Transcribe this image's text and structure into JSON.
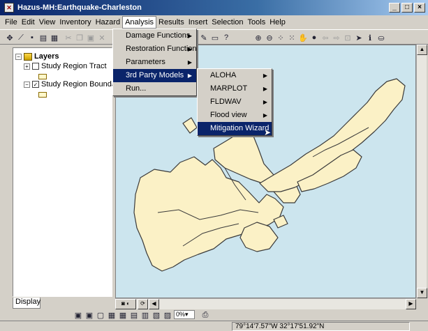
{
  "window": {
    "title": "Hazus-MH:Earthquake-Charleston"
  },
  "menubar": {
    "items": [
      "File",
      "Edit",
      "View",
      "Inventory",
      "Hazard",
      "Analysis",
      "Results",
      "Insert",
      "Selection",
      "Tools",
      "Help"
    ]
  },
  "analysis_menu": {
    "items": [
      {
        "label": "Damage Functions",
        "submenu": true
      },
      {
        "label": "Restoration Function",
        "submenu": true
      },
      {
        "label": "Parameters",
        "submenu": true
      },
      {
        "label": "3rd Party Models",
        "submenu": true,
        "selected": true
      },
      {
        "label": "Run...",
        "submenu": false
      }
    ]
  },
  "third_party_menu": {
    "items": [
      {
        "label": "ALOHA",
        "submenu": true
      },
      {
        "label": "MARPLOT",
        "submenu": true
      },
      {
        "label": "FLDWAV",
        "submenu": true
      },
      {
        "label": "Flood view",
        "submenu": true
      },
      {
        "label": "Mitigation Wizard",
        "submenu": false,
        "selected": true
      }
    ]
  },
  "toc": {
    "root_label": "Layers",
    "layers": [
      {
        "label": "Study Region Tract",
        "checked": false
      },
      {
        "label": "Study Region Boundary",
        "checked": true
      }
    ],
    "tab_label": "Display"
  },
  "drawing_toolbar": {
    "zoom_value": "0%"
  },
  "status": {
    "coordinates": "79°14'7.57\"W  32°17'51.92\"N"
  },
  "colors": {
    "map_water": "#cce5ee",
    "map_land": "#fbf1c6",
    "selection": "#0a246a"
  }
}
